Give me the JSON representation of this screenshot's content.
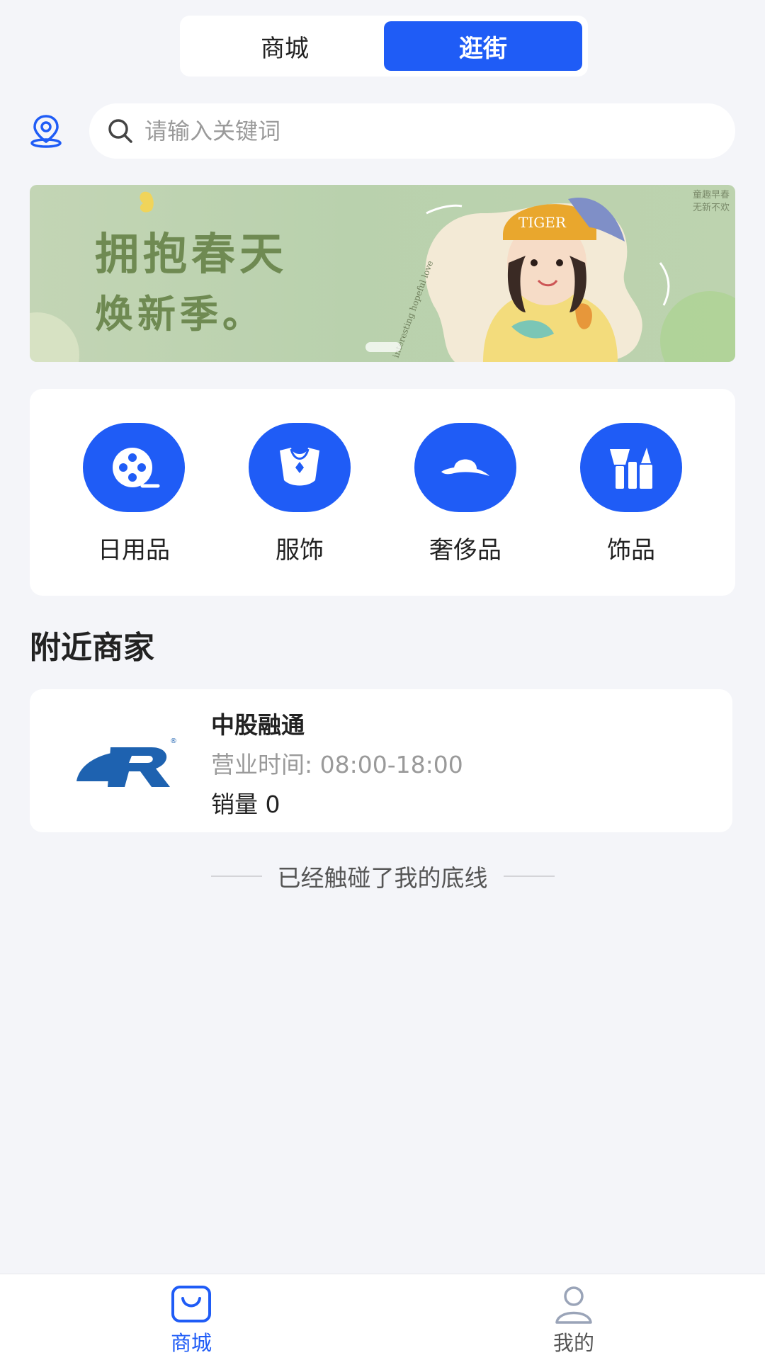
{
  "colors": {
    "accent": "#1f5cf6",
    "background": "#f4f5f9",
    "muted_text": "#9a9a9a"
  },
  "header": {
    "tabs": [
      {
        "label": "商城",
        "active": false
      },
      {
        "label": "逛街",
        "active": true
      }
    ]
  },
  "search": {
    "placeholder": "请输入关键词",
    "icon": "search-icon",
    "location_icon": "location-pin-icon"
  },
  "banner": {
    "headline": "拥抱春天",
    "subline": "焕新季。",
    "tag_line_1": "童趣早春",
    "tag_line_2": "无新不欢",
    "cap_text": "TIGER",
    "script_text": "interesting hopeful love"
  },
  "categories": [
    {
      "label": "日用品",
      "icon": "film-reel-icon"
    },
    {
      "label": "服饰",
      "icon": "necklace-shirt-icon"
    },
    {
      "label": "奢侈品",
      "icon": "sun-hat-icon"
    },
    {
      "label": "饰品",
      "icon": "cosmetics-icon"
    }
  ],
  "nearby": {
    "title": "附近商家",
    "merchants": [
      {
        "name": "中股融通",
        "hours": "营业时间: 08:00-18:00",
        "sales": "销量 0",
        "logo_text": "®"
      }
    ]
  },
  "end_text": "已经触碰了我的底线",
  "tabbar": {
    "items": [
      {
        "label": "商城",
        "icon": "shopping-bag-icon",
        "active": true
      },
      {
        "label": "我的",
        "icon": "user-icon",
        "active": false
      }
    ]
  }
}
